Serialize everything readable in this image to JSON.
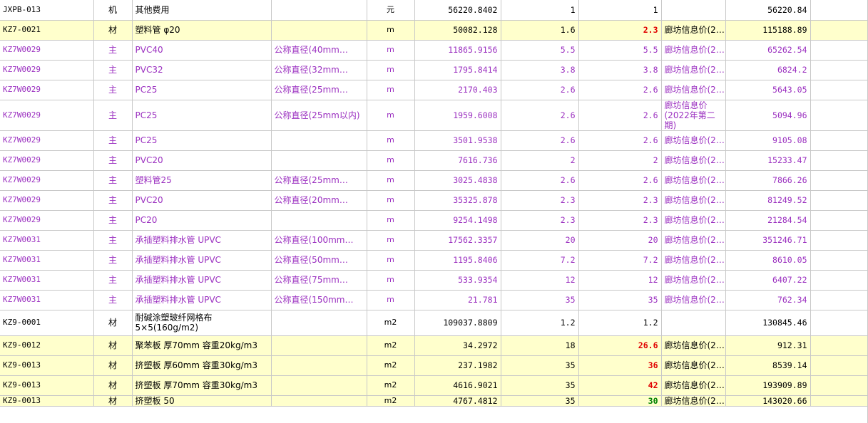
{
  "colors": {
    "highlight_row": "#ffffcc",
    "main_text": "#9b30c0",
    "adjusted_price": "#e00000",
    "adjusted_price_green": "#008000",
    "grid": "#c8c8c8"
  },
  "rows": [
    {
      "code": "JXPB-013",
      "type": "机",
      "name": "其他费用",
      "spec": "",
      "unit": "元",
      "qty": "56220.8402",
      "budget_price": "1",
      "market_price": "1",
      "price_source": "",
      "total": "56220.84",
      "style": "normal",
      "price_style": ""
    },
    {
      "code": "KZ7-0021",
      "type": "材",
      "name": "塑料管 φ20",
      "spec": "",
      "unit": "m",
      "qty": "50082.128",
      "budget_price": "1.6",
      "market_price": "2.3",
      "price_source": "廊坊信息价(2…",
      "total": "115188.89",
      "style": "hl",
      "price_style": "red"
    },
    {
      "code": "KZ7W0029",
      "type": "主",
      "name": "PVC40",
      "spec": "公称直径(40mm…",
      "unit": "m",
      "qty": "11865.9156",
      "budget_price": "5.5",
      "market_price": "5.5",
      "price_source": "廊坊信息价(2…",
      "total": "65262.54",
      "style": "main",
      "price_style": ""
    },
    {
      "code": "KZ7W0029",
      "type": "主",
      "name": "PVC32",
      "spec": "公称直径(32mm…",
      "unit": "m",
      "qty": "1795.8414",
      "budget_price": "3.8",
      "market_price": "3.8",
      "price_source": "廊坊信息价(2…",
      "total": "6824.2",
      "style": "main",
      "price_style": ""
    },
    {
      "code": "KZ7W0029",
      "type": "主",
      "name": "PC25",
      "spec": "公称直径(25mm…",
      "unit": "m",
      "qty": "2170.403",
      "budget_price": "2.6",
      "market_price": "2.6",
      "price_source": "廊坊信息价(2…",
      "total": "5643.05",
      "style": "main",
      "price_style": ""
    },
    {
      "code": "KZ7W0029",
      "type": "主",
      "name": "PC25",
      "spec": "公称直径(25mm以内)",
      "unit": "m",
      "qty": "1959.6008",
      "budget_price": "2.6",
      "market_price": "2.6",
      "price_source": "廊坊信息价(2022年第二期)",
      "total": "5094.96",
      "style": "main tall",
      "price_style": ""
    },
    {
      "code": "KZ7W0029",
      "type": "主",
      "name": "PC25",
      "spec": "",
      "unit": "m",
      "qty": "3501.9538",
      "budget_price": "2.6",
      "market_price": "2.6",
      "price_source": "廊坊信息价(2…",
      "total": "9105.08",
      "style": "main",
      "price_style": ""
    },
    {
      "code": "KZ7W0029",
      "type": "主",
      "name": "PVC20",
      "spec": "",
      "unit": "m",
      "qty": "7616.736",
      "budget_price": "2",
      "market_price": "2",
      "price_source": "廊坊信息价(2…",
      "total": "15233.47",
      "style": "main",
      "price_style": ""
    },
    {
      "code": "KZ7W0029",
      "type": "主",
      "name": "塑料管25",
      "spec": "公称直径(25mm…",
      "unit": "m",
      "qty": "3025.4838",
      "budget_price": "2.6",
      "market_price": "2.6",
      "price_source": "廊坊信息价(2…",
      "total": "7866.26",
      "style": "main",
      "price_style": ""
    },
    {
      "code": "KZ7W0029",
      "type": "主",
      "name": "PVC20",
      "spec": "公称直径(20mm…",
      "unit": "m",
      "qty": "35325.878",
      "budget_price": "2.3",
      "market_price": "2.3",
      "price_source": "廊坊信息价(2…",
      "total": "81249.52",
      "style": "main",
      "price_style": ""
    },
    {
      "code": "KZ7W0029",
      "type": "主",
      "name": "PC20",
      "spec": "",
      "unit": "m",
      "qty": "9254.1498",
      "budget_price": "2.3",
      "market_price": "2.3",
      "price_source": "廊坊信息价(2…",
      "total": "21284.54",
      "style": "main",
      "price_style": ""
    },
    {
      "code": "KZ7W0031",
      "type": "主",
      "name": "承插塑料排水管 UPVC",
      "spec": "公称直径(100mm…",
      "unit": "m",
      "qty": "17562.3357",
      "budget_price": "20",
      "market_price": "20",
      "price_source": "廊坊信息价(2…",
      "total": "351246.71",
      "style": "main",
      "price_style": ""
    },
    {
      "code": "KZ7W0031",
      "type": "主",
      "name": "承插塑料排水管 UPVC",
      "spec": "公称直径(50mm…",
      "unit": "m",
      "qty": "1195.8406",
      "budget_price": "7.2",
      "market_price": "7.2",
      "price_source": "廊坊信息价(2…",
      "total": "8610.05",
      "style": "main",
      "price_style": ""
    },
    {
      "code": "KZ7W0031",
      "type": "主",
      "name": "承插塑料排水管 UPVC",
      "spec": "公称直径(75mm…",
      "unit": "m",
      "qty": "533.9354",
      "budget_price": "12",
      "market_price": "12",
      "price_source": "廊坊信息价(2…",
      "total": "6407.22",
      "style": "main",
      "price_style": ""
    },
    {
      "code": "KZ7W0031",
      "type": "主",
      "name": "承插塑料排水管 UPVC",
      "spec": "公称直径(150mm…",
      "unit": "m",
      "qty": "21.781",
      "budget_price": "35",
      "market_price": "35",
      "price_source": "廊坊信息价(2…",
      "total": "762.34",
      "style": "main",
      "price_style": ""
    },
    {
      "code": "KZ9-0001",
      "type": "材",
      "name": "耐碱涂塑玻纤网格布 5×5(160g/m2)",
      "spec": "",
      "unit": "m2",
      "qty": "109037.8809",
      "budget_price": "1.2",
      "market_price": "1.2",
      "price_source": "",
      "total": "130845.46",
      "style": "normal tall",
      "price_style": ""
    },
    {
      "code": "KZ9-0012",
      "type": "材",
      "name": "聚苯板 厚70mm 容重20kg/m3",
      "spec": "",
      "unit": "m2",
      "qty": "34.2972",
      "budget_price": "18",
      "market_price": "26.6",
      "price_source": "廊坊信息价(2…",
      "total": "912.31",
      "style": "hl",
      "price_style": "red"
    },
    {
      "code": "KZ9-0013",
      "type": "材",
      "name": "挤塑板 厚60mm 容重30kg/m3",
      "spec": "",
      "unit": "m2",
      "qty": "237.1982",
      "budget_price": "35",
      "market_price": "36",
      "price_source": "廊坊信息价(2…",
      "total": "8539.14",
      "style": "hl",
      "price_style": "red"
    },
    {
      "code": "KZ9-0013",
      "type": "材",
      "name": "挤塑板 厚70mm 容重30kg/m3",
      "spec": "",
      "unit": "m2",
      "qty": "4616.9021",
      "budget_price": "35",
      "market_price": "42",
      "price_source": "廊坊信息价(2…",
      "total": "193909.89",
      "style": "hl",
      "price_style": "red"
    },
    {
      "code": "KZ9-0013",
      "type": "材",
      "name": "挤塑板 50",
      "spec": "",
      "unit": "m2",
      "qty": "4767.4812",
      "budget_price": "35",
      "market_price": "30",
      "price_source": "廊坊信息价(2…",
      "total": "143020.66",
      "style": "hl partial",
      "price_style": "green"
    }
  ]
}
